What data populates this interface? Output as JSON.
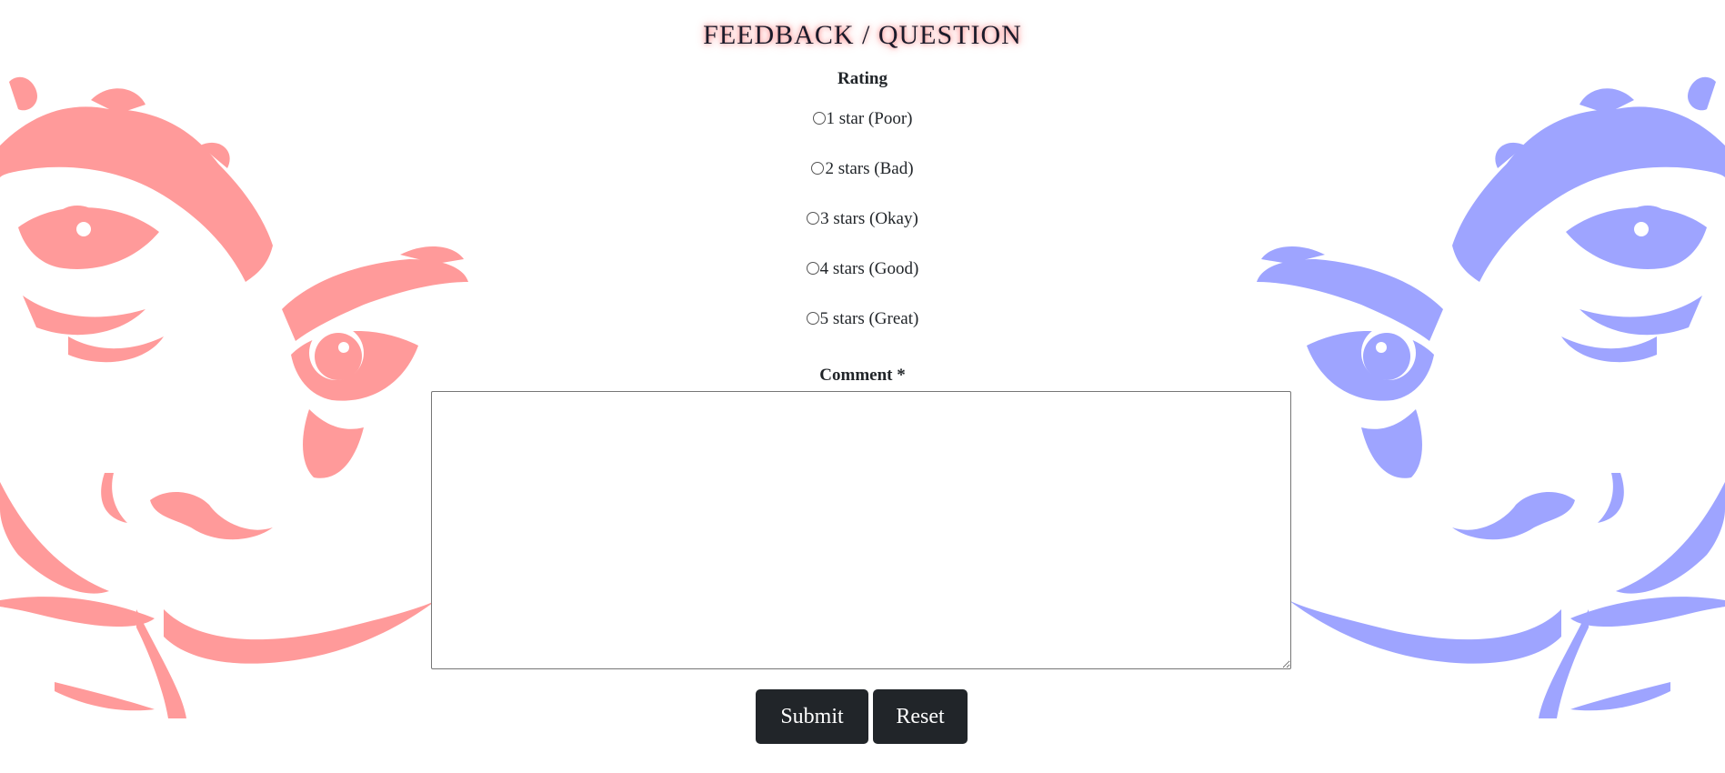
{
  "header": {
    "title": "FEEDBACK / QUESTION"
  },
  "form": {
    "rating_label": "Rating",
    "rating_options": [
      "1 star (Poor)",
      "2 stars (Bad)",
      "3 stars (Okay)",
      "4 stars (Good)",
      "5 stars (Great)"
    ],
    "comment_label": "Comment *",
    "comment_value": "",
    "submit_label": "Submit",
    "reset_label": "Reset"
  },
  "colors": {
    "left_face": "#ff9a9a",
    "right_face": "#9ea4ff",
    "button_bg": "#212529",
    "title_glow": "#ff7b7b"
  },
  "decor": {
    "left_image": "dali-face-illustration-pink",
    "right_image": "dali-face-illustration-blue"
  }
}
